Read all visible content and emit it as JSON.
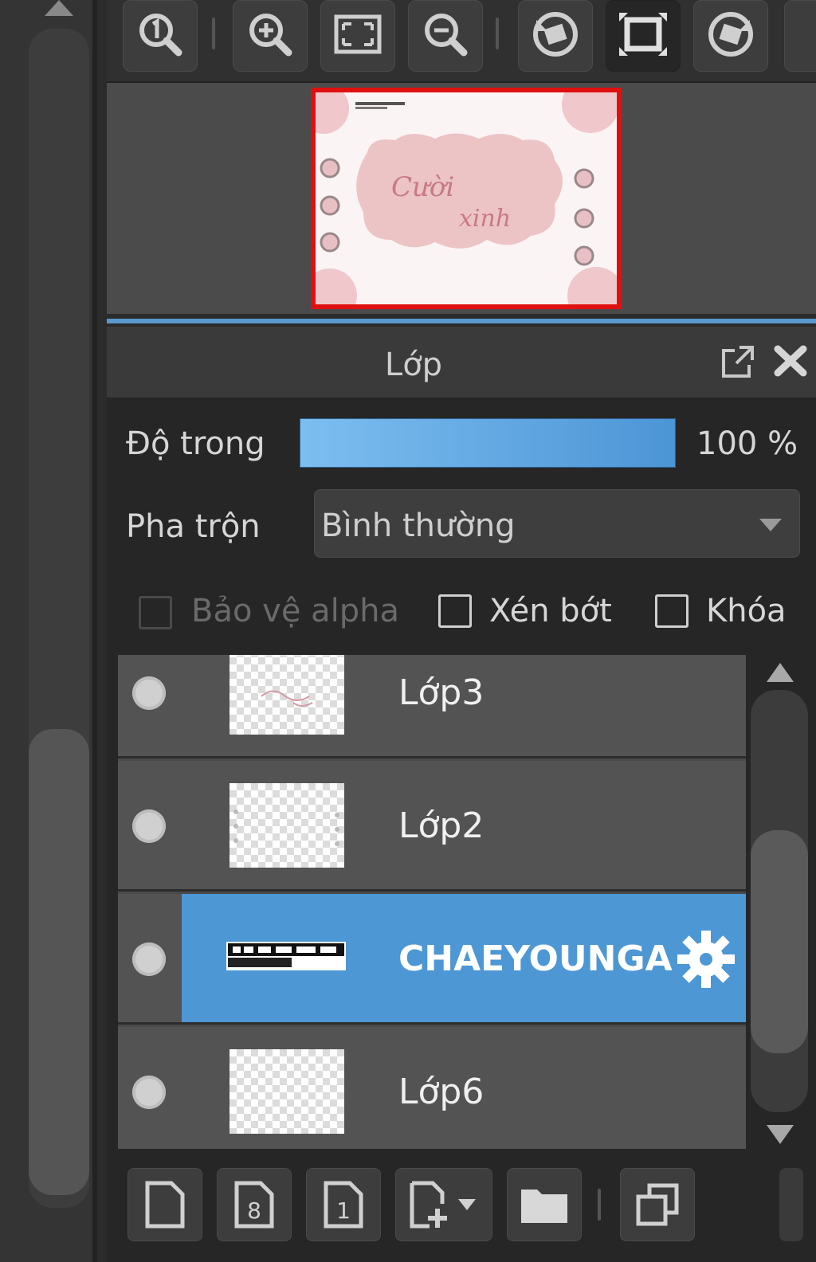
{
  "panel": {
    "title": "Lớp",
    "opacity_label": "Độ trong",
    "opacity_value": "100 %",
    "opacity_fraction": 1.0,
    "blend_label": "Pha trộn",
    "blend_value": "Bình thường",
    "checkboxes": {
      "protect_alpha": "Bảo vệ alpha",
      "clip": "Xén bớt",
      "lock": "Khóa"
    }
  },
  "navigator": {
    "preview_text_line1": "Cười",
    "preview_text_line2": "xinh"
  },
  "layers": [
    {
      "name": "Lớp3",
      "selected": false
    },
    {
      "name": "Lớp2",
      "selected": false
    },
    {
      "name": "CHAEYOUNGA",
      "selected": true
    },
    {
      "name": "Lớp6",
      "selected": false
    }
  ],
  "colors": {
    "accent": "#4d97d4",
    "navigator_border": "#e01010",
    "opacity_bar_start": "#7dbef0",
    "opacity_bar_end": "#4c95d6"
  },
  "icons": {
    "toolbar": [
      "zoom-actual-icon",
      "zoom-in-icon",
      "fit-screen-icon",
      "zoom-out-icon",
      "rotate-left-icon",
      "fullscreen-icon",
      "rotate-right-icon"
    ],
    "bottom": [
      "new-layer-icon",
      "new-8bit-layer-icon",
      "new-1bit-layer-icon",
      "add-layer-menu-icon",
      "folder-icon",
      "duplicate-layer-icon"
    ]
  }
}
